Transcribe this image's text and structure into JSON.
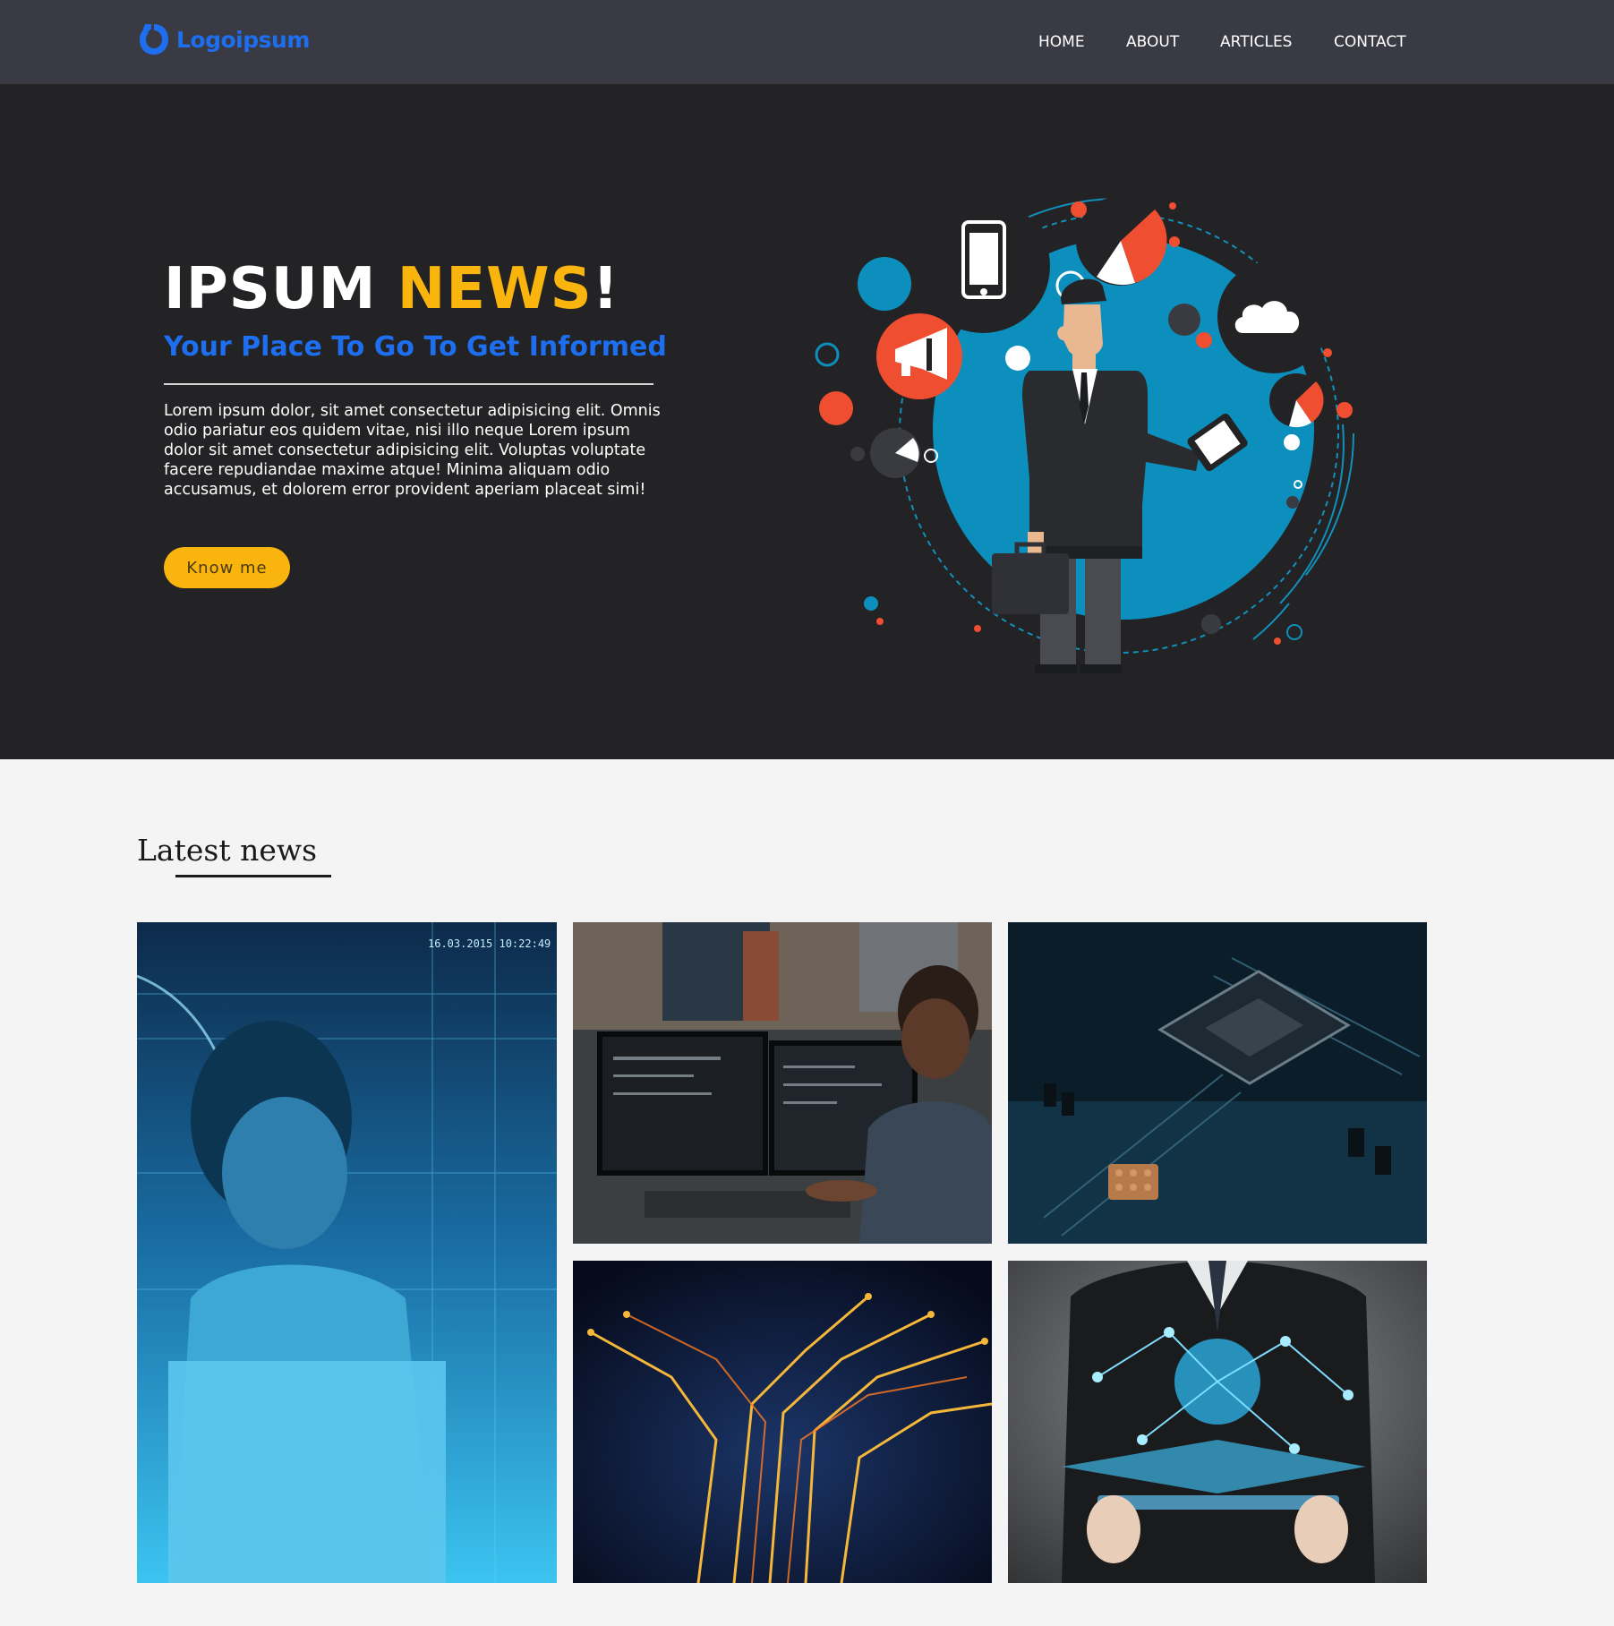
{
  "brand": {
    "logo_text": "Logoipsum",
    "logo_icon": "logoipsum-mark-icon",
    "color": "#1d6ff0"
  },
  "nav": {
    "items": [
      {
        "label": "HOME"
      },
      {
        "label": "ABOUT"
      },
      {
        "label": "ARTICLES"
      },
      {
        "label": "CONTACT"
      }
    ]
  },
  "hero": {
    "title_part1": "IPSUM ",
    "title_accent": "NEWS",
    "title_end": "!",
    "subtitle": "Your Place To Go To Get Informed",
    "body": "Lorem ipsum dolor, sit amet consectetur adipisicing elit. Omnis odio pariatur eos quidem vitae, nisi illo neque Lorem ipsum dolor sit amet consectetur adipisicing elit. Voluptas voluptate facere repudiandae maxime atque! Minima aliquam odio accusamus, et dolorem error provident aperiam placeat simi!",
    "button_label": "Know me",
    "illustration_icon": "businessman-illustration",
    "accent_color": "#f9b40e",
    "background": "#232325"
  },
  "latest": {
    "title": "Latest news",
    "cards": [
      {
        "image": "man-laptop-hologram-image",
        "overlay_timestamp": "16.03.2015 10:22:49"
      },
      {
        "image": "developer-at-monitors-image"
      },
      {
        "image": "circuit-board-cpu-image"
      },
      {
        "image": "glowing-circuit-traces-image"
      },
      {
        "image": "businessman-tablet-network-image"
      }
    ]
  },
  "colors": {
    "navbar": "#393a43",
    "page_background": "#f4f4f4",
    "link_text": "#ffffff"
  }
}
